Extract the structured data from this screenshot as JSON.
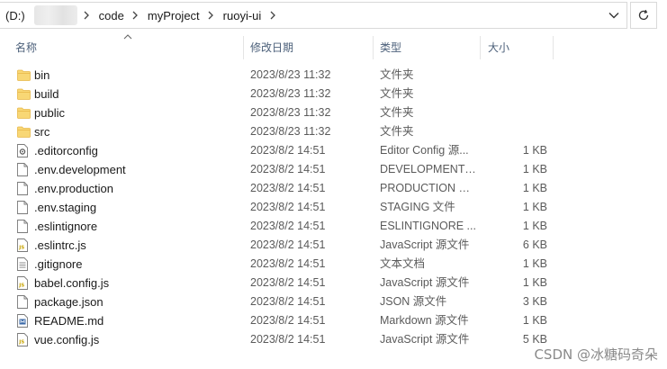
{
  "address_bar": {
    "crumbs": [
      "(D:)",
      "code",
      "myProject",
      "ruoyi-ui"
    ]
  },
  "columns": {
    "name": "名称",
    "date": "修改日期",
    "type": "类型",
    "size": "大小"
  },
  "files": [
    {
      "name": "bin",
      "date": "2023/8/23 11:32",
      "type": "文件夹",
      "size": "",
      "icon": "folder-icon"
    },
    {
      "name": "build",
      "date": "2023/8/23 11:32",
      "type": "文件夹",
      "size": "",
      "icon": "folder-icon"
    },
    {
      "name": "public",
      "date": "2023/8/23 11:32",
      "type": "文件夹",
      "size": "",
      "icon": "folder-icon"
    },
    {
      "name": "src",
      "date": "2023/8/23 11:32",
      "type": "文件夹",
      "size": "",
      "icon": "folder-icon"
    },
    {
      "name": ".editorconfig",
      "date": "2023/8/2 14:51",
      "type": "Editor Config 源...",
      "size": "1 KB",
      "icon": "config-file-icon"
    },
    {
      "name": ".env.development",
      "date": "2023/8/2 14:51",
      "type": "DEVELOPMENT ...",
      "size": "1 KB",
      "icon": "blank-file-icon"
    },
    {
      "name": ".env.production",
      "date": "2023/8/2 14:51",
      "type": "PRODUCTION 文件",
      "size": "1 KB",
      "icon": "blank-file-icon"
    },
    {
      "name": ".env.staging",
      "date": "2023/8/2 14:51",
      "type": "STAGING 文件",
      "size": "1 KB",
      "icon": "blank-file-icon"
    },
    {
      "name": ".eslintignore",
      "date": "2023/8/2 14:51",
      "type": "ESLINTIGNORE ...",
      "size": "1 KB",
      "icon": "blank-file-icon"
    },
    {
      "name": ".eslintrc.js",
      "date": "2023/8/2 14:51",
      "type": "JavaScript 源文件",
      "size": "6 KB",
      "icon": "js-file-icon"
    },
    {
      "name": ".gitignore",
      "date": "2023/8/2 14:51",
      "type": "文本文档",
      "size": "1 KB",
      "icon": "text-file-icon"
    },
    {
      "name": "babel.config.js",
      "date": "2023/8/2 14:51",
      "type": "JavaScript 源文件",
      "size": "1 KB",
      "icon": "js-file-icon"
    },
    {
      "name": "package.json",
      "date": "2023/8/2 14:51",
      "type": "JSON 源文件",
      "size": "3 KB",
      "icon": "blank-file-icon"
    },
    {
      "name": "README.md",
      "date": "2023/8/2 14:51",
      "type": "Markdown 源文件",
      "size": "1 KB",
      "icon": "markdown-file-icon"
    },
    {
      "name": "vue.config.js",
      "date": "2023/8/2 14:51",
      "type": "JavaScript 源文件",
      "size": "5 KB",
      "icon": "js-file-icon"
    }
  ],
  "watermark": "CSDN @冰糖码奇朵",
  "colors": {
    "folder": "#f8d775",
    "folder_dark": "#e8b84a",
    "header_text": "#4c607a"
  }
}
